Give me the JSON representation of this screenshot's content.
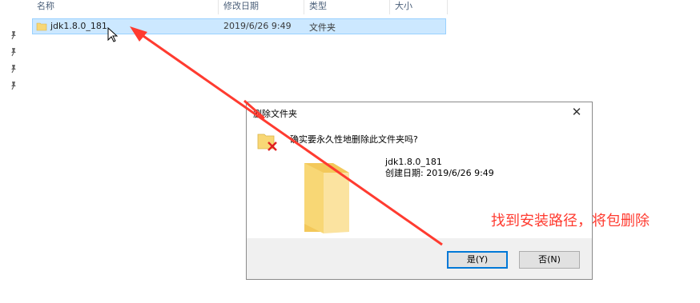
{
  "columns": {
    "name": "名称",
    "modified": "修改日期",
    "type": "类型",
    "size": "大小"
  },
  "file_row": {
    "name": "jdk1.8.0_181",
    "modified": "2019/6/26 9:49",
    "type": "文件夹"
  },
  "dialog": {
    "title": "删除文件夹",
    "close_glyph": "✕",
    "question": "确实要永久性地删除此文件夹吗?",
    "item_name": "jdk1.8.0_181",
    "item_created": "创建日期: 2019/6/26 9:49",
    "yes_label": "是(Y)",
    "no_label": "否(N)"
  },
  "annotation": {
    "text": "找到安装路径，将包删除",
    "color": "#ff3b30"
  },
  "icons": [
    "pin-icon",
    "folder-icon",
    "mouse-cursor-icon",
    "delete-folder-icon",
    "large-folder-icon",
    "close-icon",
    "arrow-annotation"
  ],
  "colors": {
    "selection": "#cce8ff",
    "selection_border": "#99d1ff",
    "folder_yellow": "#f8d775",
    "primary_button_border": "#0078d7",
    "delete_x": "#e02020"
  }
}
